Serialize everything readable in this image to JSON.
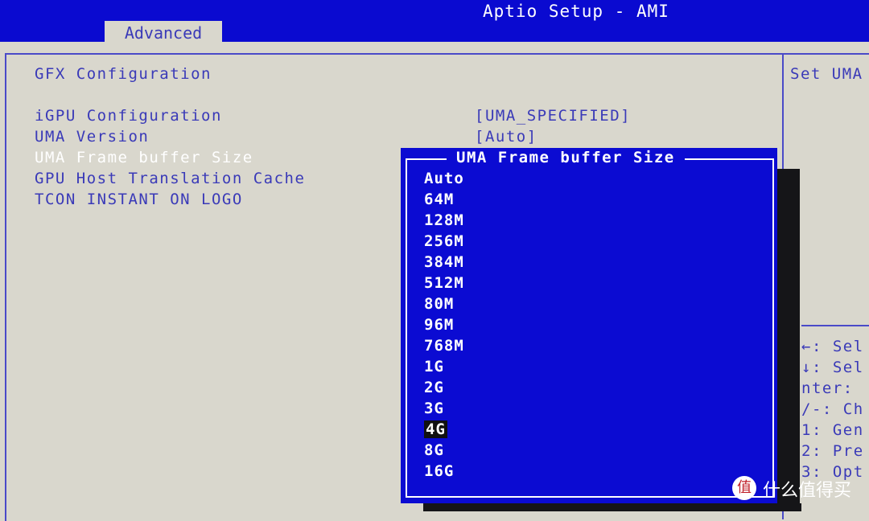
{
  "header": {
    "title": "Aptio Setup - AMI",
    "tab": "Advanced"
  },
  "main": {
    "section": "GFX Configuration",
    "items": [
      {
        "label": "iGPU Configuration",
        "value": "[UMA_SPECIFIED]"
      },
      {
        "label": "UMA Version",
        "value": "[Auto]"
      },
      {
        "label": "UMA Frame buffer Size",
        "value": ""
      },
      {
        "label": "GPU Host Translation Cache",
        "value": ""
      },
      {
        "label": "TCON INSTANT ON LOGO",
        "value": ""
      }
    ]
  },
  "popup": {
    "title": "UMA Frame buffer Size",
    "options": [
      "Auto",
      "64M",
      "128M",
      "256M",
      "384M",
      "512M",
      "80M",
      "96M",
      "768M",
      "1G",
      "2G",
      "3G",
      "4G",
      "8G",
      "16G"
    ],
    "selected": "4G"
  },
  "help": {
    "description": "Set UMA",
    "keys": [
      "←: Sel",
      "↓: Sel",
      "nter:",
      "/-: Ch",
      "1: Gen",
      "2: Pre",
      "3: Opt"
    ]
  },
  "watermark": {
    "text": "什么值得买",
    "logo": "值"
  }
}
